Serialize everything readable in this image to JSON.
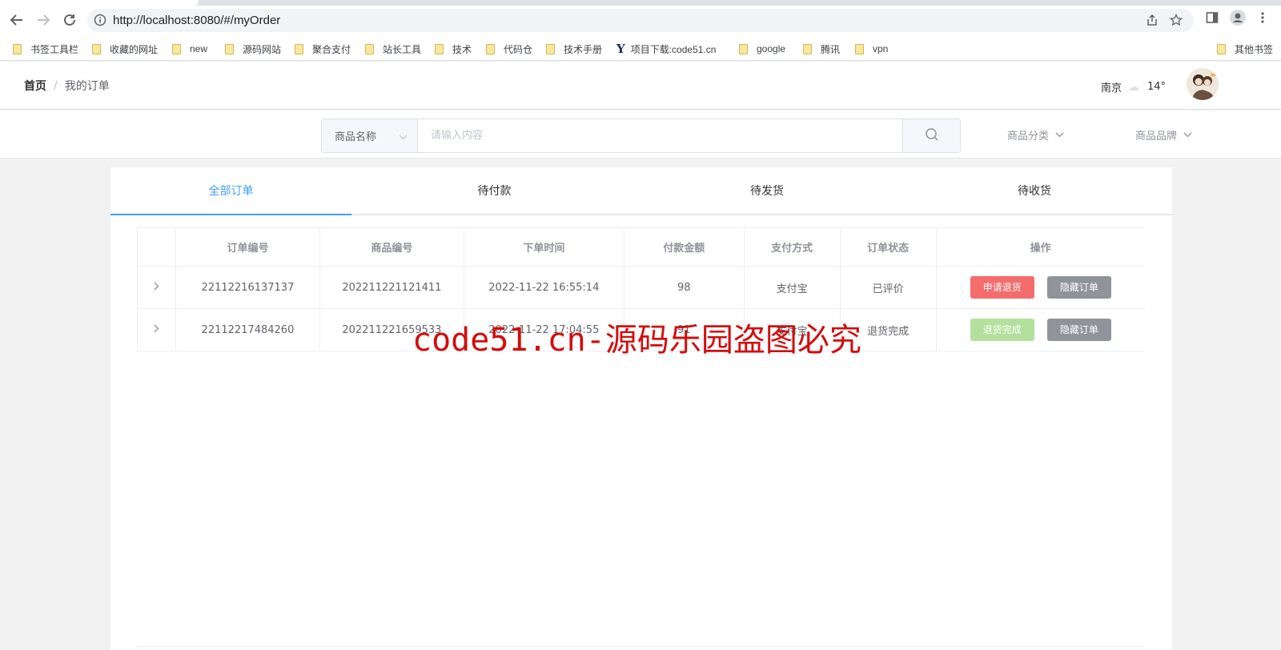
{
  "browser": {
    "url": "http://localhost:8080/#/myOrder",
    "bookmarks": [
      {
        "label": "书签工具栏",
        "icon": "folder"
      },
      {
        "label": "收藏的网址",
        "icon": "folder"
      },
      {
        "label": "new",
        "icon": "folder"
      },
      {
        "label": "源码网站",
        "icon": "folder"
      },
      {
        "label": "聚合支付",
        "icon": "folder"
      },
      {
        "label": "站长工具",
        "icon": "folder"
      },
      {
        "label": "技术",
        "icon": "folder"
      },
      {
        "label": "代码仓",
        "icon": "folder"
      },
      {
        "label": "技术手册",
        "icon": "folder"
      },
      {
        "label": "项目下载:code51.cn",
        "icon": "y-logo"
      },
      {
        "label": "google",
        "icon": "folder"
      },
      {
        "label": "腾讯",
        "icon": "folder"
      },
      {
        "label": "vpn",
        "icon": "folder"
      }
    ],
    "other_bookmarks": "其他书签"
  },
  "header": {
    "breadcrumb": {
      "home": "首页",
      "separator": "/",
      "current": "我的订单"
    },
    "weather": {
      "city": "南京",
      "temperature": "14°"
    }
  },
  "search": {
    "select_label": "商品名称",
    "placeholder": "请输入内容",
    "filters": [
      "商品分类",
      "商品品牌"
    ]
  },
  "tabs": [
    "全部订单",
    "待付款",
    "待发货",
    "待收货"
  ],
  "active_tab": "全部订单",
  "table": {
    "columns": [
      "订单编号",
      "商品编号",
      "下单时间",
      "付款金额",
      "支付方式",
      "订单状态",
      "操作"
    ],
    "rows": [
      {
        "order_no": "22112216137137",
        "product_no": "202211221121411",
        "time": "2022-11-22 16:55:14",
        "amount": "98",
        "payment": "支付宝",
        "status": "已评价",
        "action_primary": "申请退货",
        "action_secondary": "隐藏订单"
      },
      {
        "order_no": "22112217484260",
        "product_no": "202211221659533",
        "time": "2022-11-22 17:04:55",
        "amount": "91",
        "payment": "支付宝",
        "status": "退货完成",
        "action_primary": "退货完成",
        "action_secondary": "隐藏订单"
      }
    ]
  },
  "watermark": "code51.cn-源码乐园盗图必究",
  "colors": {
    "accent": "#409eff",
    "danger": "#f56c6c",
    "info": "#909399",
    "success_light": "#b3e19d",
    "watermark": "#d40c0c"
  }
}
